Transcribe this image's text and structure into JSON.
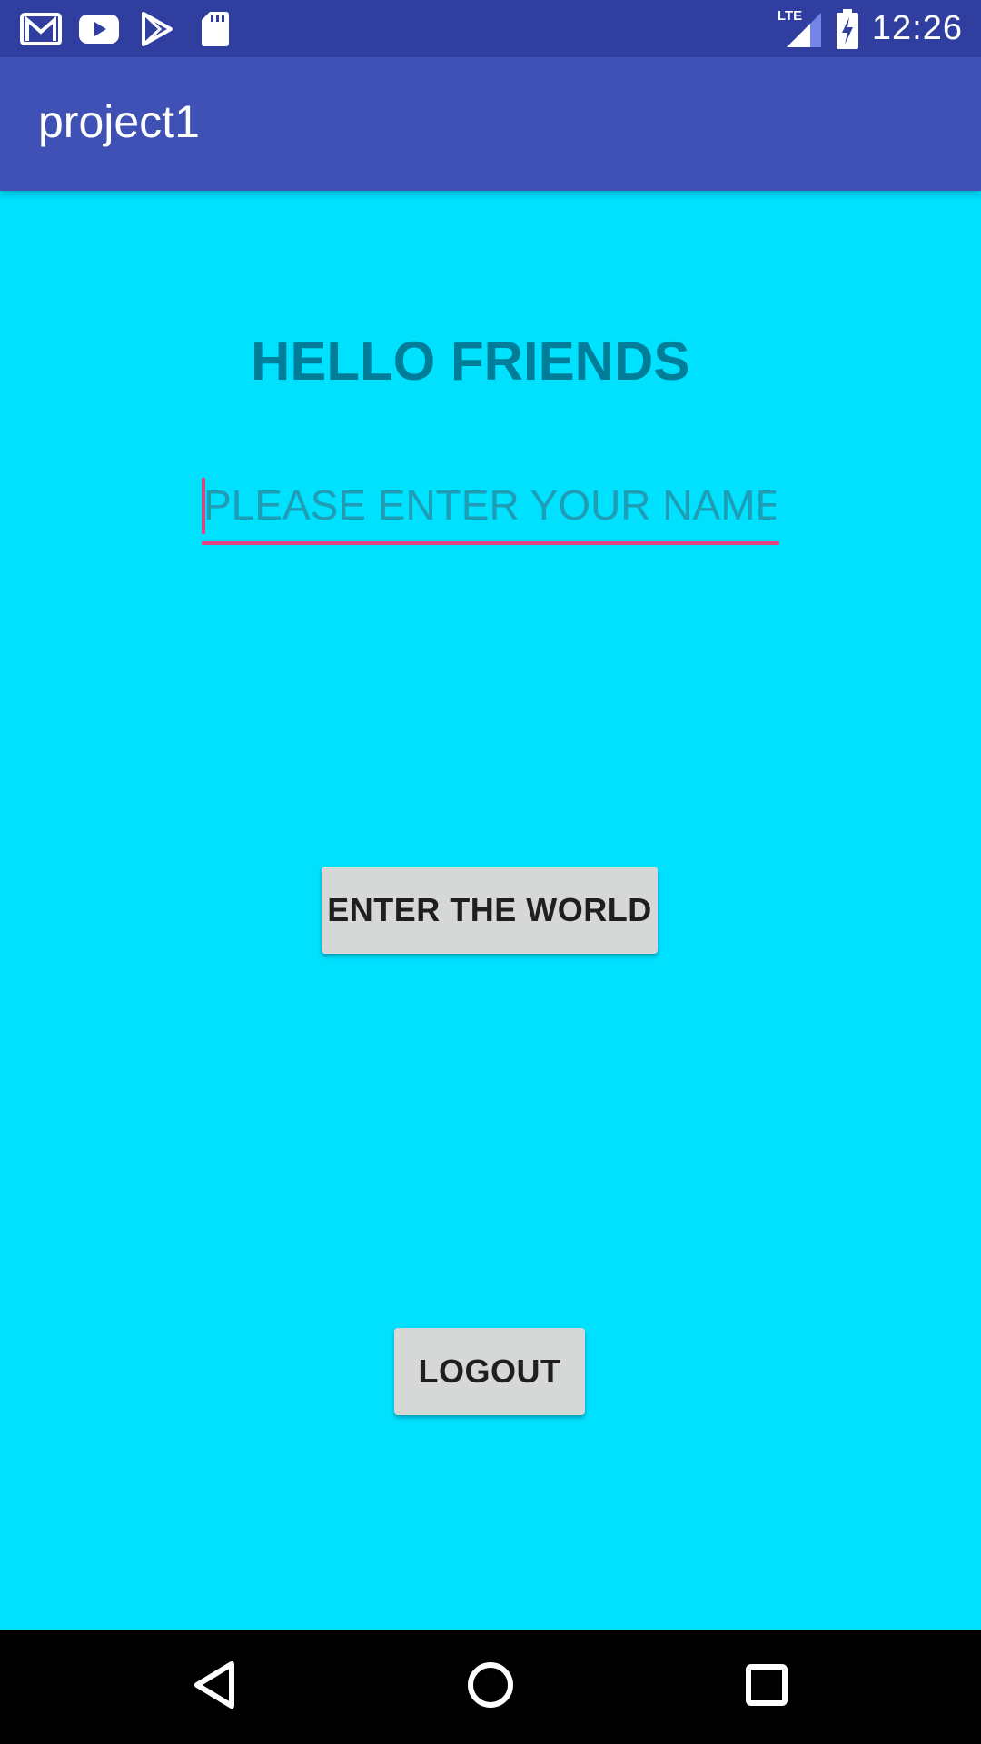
{
  "status_bar": {
    "time": "12:26",
    "network": "LTE",
    "notification_icons": [
      "gmail-icon",
      "youtube-icon",
      "play-store-icon",
      "sd-card-icon"
    ]
  },
  "app_bar": {
    "title": "project1"
  },
  "main": {
    "heading": "HELLO FRIENDS",
    "name_input": {
      "value": "",
      "placeholder": "PLEASE ENTER YOUR NAME"
    },
    "enter_button_label": "ENTER THE WORLD",
    "logout_button_label": "LOGOUT"
  },
  "nav_bar": {
    "icons": [
      "back-icon",
      "home-icon",
      "recents-icon"
    ]
  },
  "colors": {
    "status_bar": "#303F9F",
    "app_bar": "#3F51B5",
    "background": "#00E0FF",
    "heading": "#007E99",
    "accent": "#E0437F",
    "button": "#D6D7D7"
  }
}
